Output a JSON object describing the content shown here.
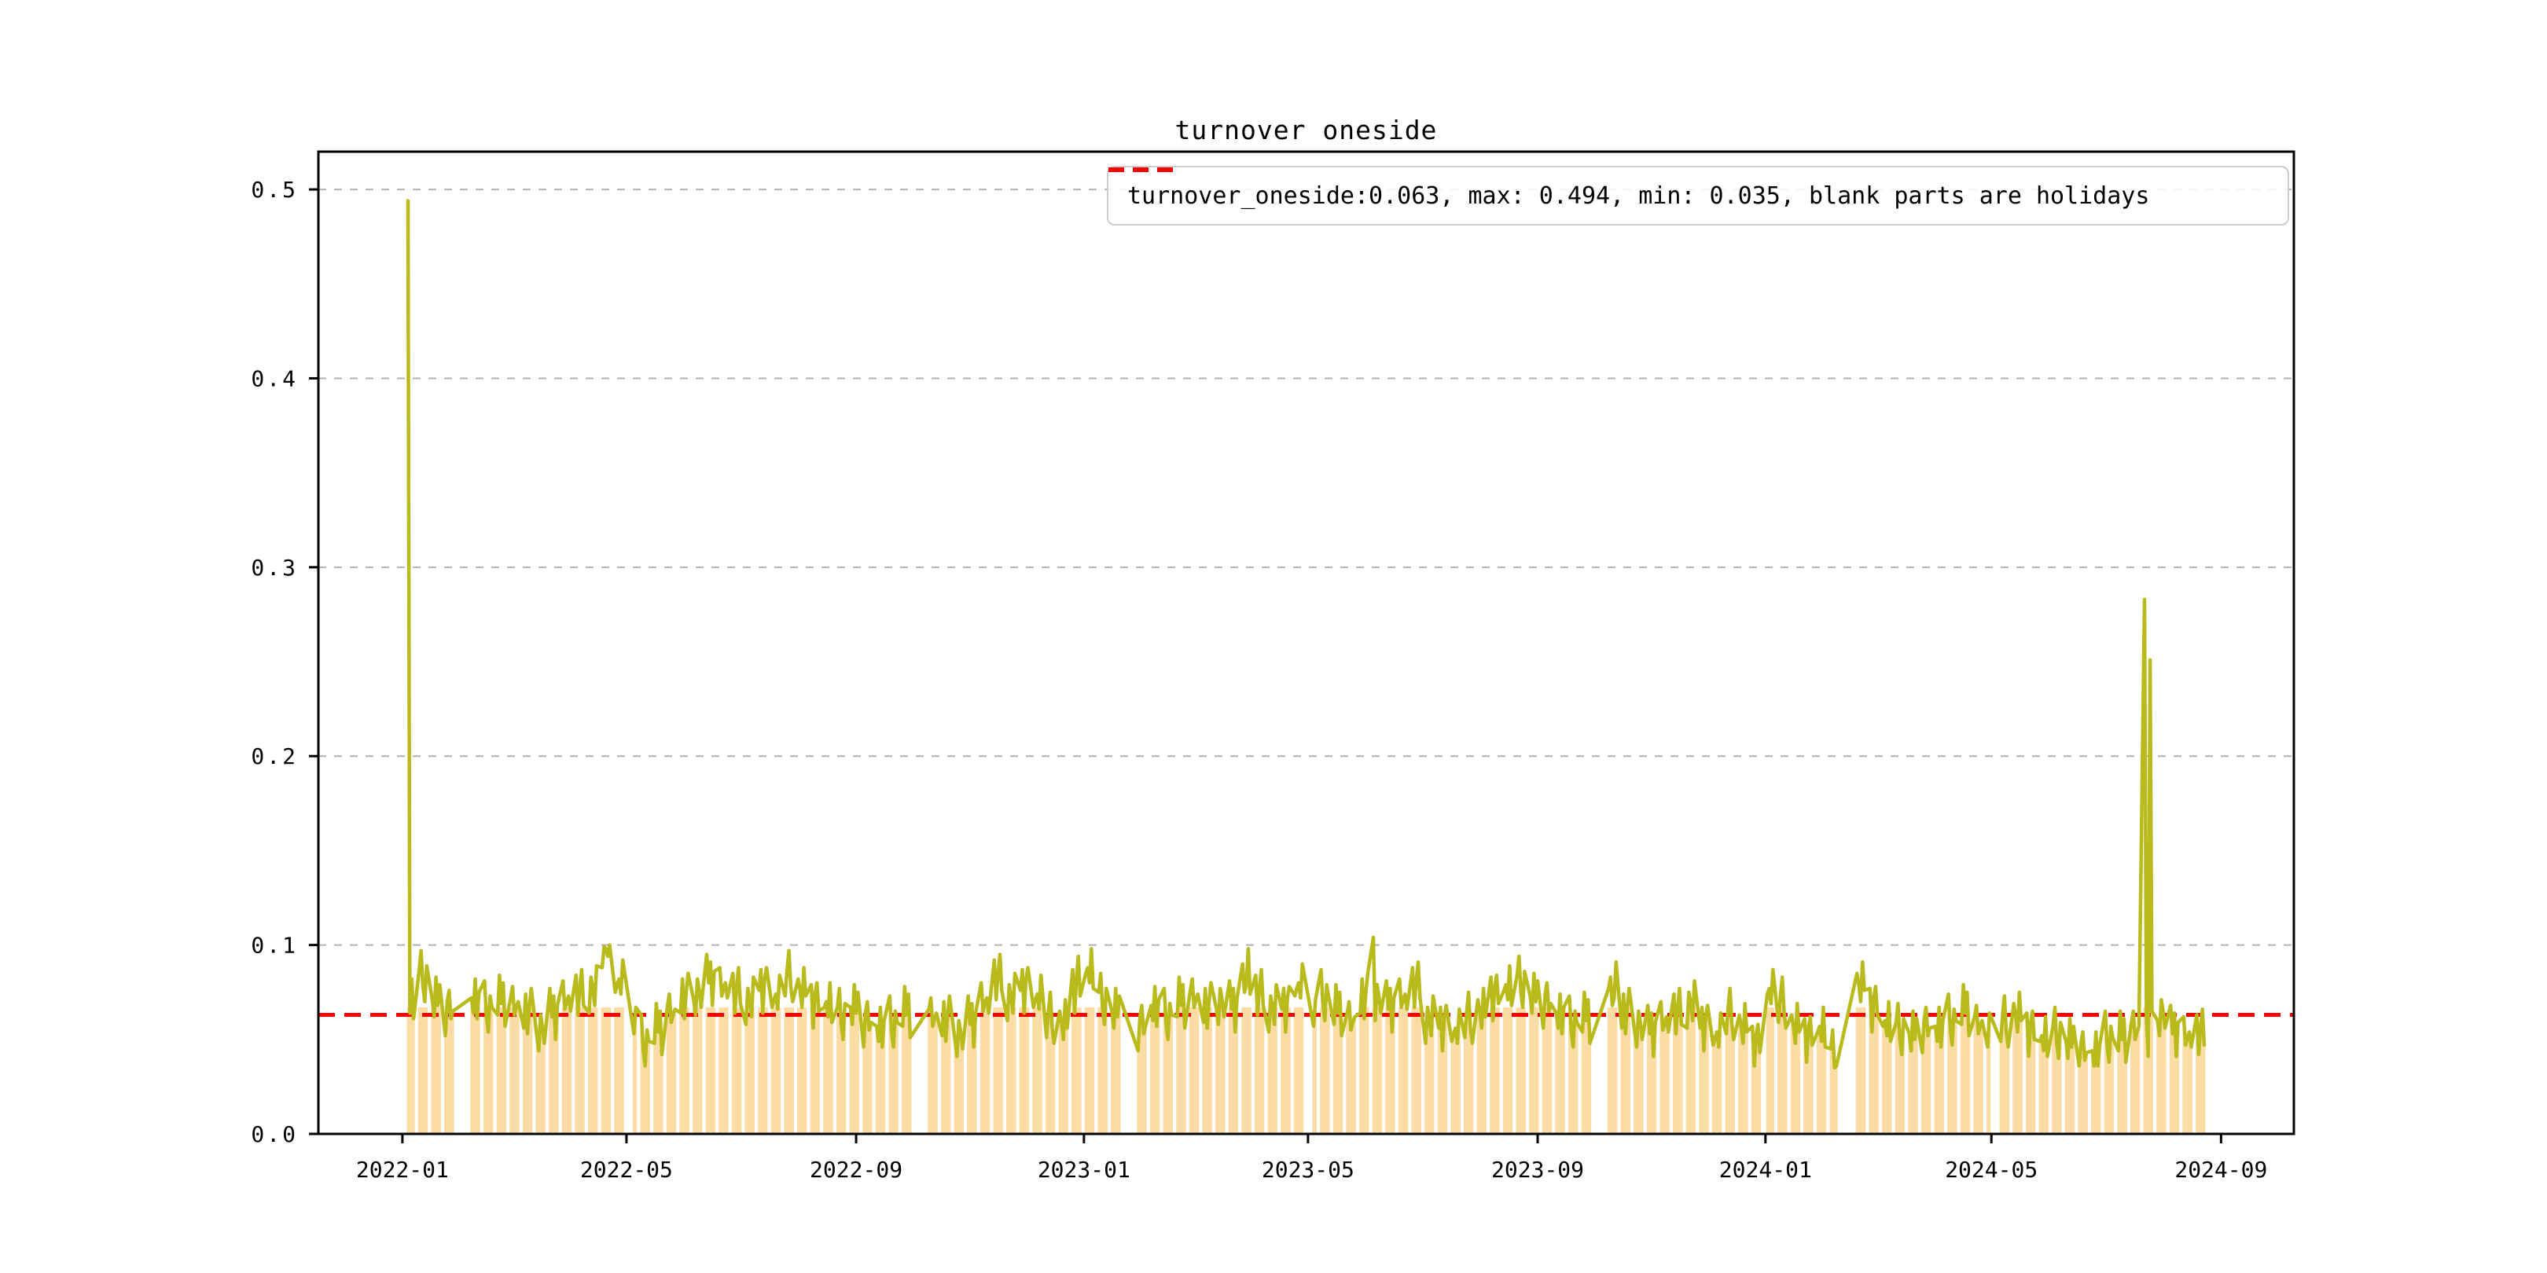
{
  "title": "turnover oneside",
  "legend": {
    "label": "turnover_oneside:0.063, max: 0.494, min: 0.035, blank parts are holidays",
    "marker": "red-dashed-line"
  },
  "chart_data": {
    "type": "line+bar",
    "title": "turnover oneside",
    "xlabel": "",
    "ylabel": "",
    "stats": {
      "mean": 0.063,
      "max": 0.494,
      "min": 0.035
    },
    "mean_line_value": 0.063,
    "ylim": [
      0,
      0.52
    ],
    "xlim_days": [
      -45,
      1013
    ],
    "y_ticks": [
      {
        "label": "0.0",
        "v": 0.0
      },
      {
        "label": "0.1",
        "v": 0.1
      },
      {
        "label": "0.2",
        "v": 0.2
      },
      {
        "label": "0.3",
        "v": 0.3
      },
      {
        "label": "0.4",
        "v": 0.4
      },
      {
        "label": "0.5",
        "v": 0.5
      }
    ],
    "x_ticks": [
      {
        "label": "2022-01",
        "day": 0
      },
      {
        "label": "2022-05",
        "day": 120
      },
      {
        "label": "2022-09",
        "day": 243
      },
      {
        "label": "2023-01",
        "day": 365
      },
      {
        "label": "2023-05",
        "day": 485
      },
      {
        "label": "2023-09",
        "day": 608
      },
      {
        "label": "2024-01",
        "day": 730
      },
      {
        "label": "2024-05",
        "day": 851
      },
      {
        "label": "2024-09",
        "day": 974
      }
    ],
    "grid": true,
    "legend_position": "upper right",
    "colors": {
      "line": "#b9ba1b",
      "bars": "#fbdca4",
      "mean_line": "#ff0000",
      "grid": "#b3b3b3",
      "spine": "#000000",
      "text": "#000000",
      "legend_border": "#cccccc"
    },
    "bar_cap": 0.067,
    "min_clamp": 0.036,
    "intra_day_deltas": [
      0.002,
      -0.006,
      0.012,
      -0.009,
      0.005,
      0.015,
      -0.004,
      -0.012,
      0.007,
      0.001,
      -0.008,
      0.013,
      -0.002,
      0.009,
      -0.014,
      0.004,
      0.01,
      -0.005,
      -0.001
    ],
    "weeks": [
      [
        2,
        0.07,
        [
          1,
          2,
          3,
          4
        ]
      ],
      [
        9,
        0.082
      ],
      [
        16,
        0.07
      ],
      [
        23,
        0.066
      ],
      [
        37,
        0.07
      ],
      [
        44,
        0.066
      ],
      [
        51,
        0.071
      ],
      [
        58,
        0.068
      ],
      [
        65,
        0.062
      ],
      [
        72,
        0.056
      ],
      [
        79,
        0.064
      ],
      [
        86,
        0.071
      ],
      [
        93,
        0.072
      ],
      [
        100,
        0.076
      ],
      [
        107,
        0.09
      ],
      [
        114,
        0.08
      ],
      [
        121,
        0.062,
        [
          3,
          4
        ]
      ],
      [
        128,
        0.048
      ],
      [
        135,
        0.056
      ],
      [
        142,
        0.064
      ],
      [
        149,
        0.07
      ],
      [
        156,
        0.075
      ],
      [
        163,
        0.082
      ],
      [
        170,
        0.078
      ],
      [
        177,
        0.073
      ],
      [
        184,
        0.07
      ],
      [
        191,
        0.078
      ],
      [
        198,
        0.072
      ],
      [
        205,
        0.082
      ],
      [
        212,
        0.075
      ],
      [
        219,
        0.07
      ],
      [
        226,
        0.068
      ],
      [
        233,
        0.062
      ],
      [
        240,
        0.066
      ],
      [
        247,
        0.06
      ],
      [
        254,
        0.055
      ],
      [
        261,
        0.058
      ],
      [
        268,
        0.065
      ],
      [
        282,
        0.062
      ],
      [
        289,
        0.058
      ],
      [
        296,
        0.053
      ],
      [
        303,
        0.06
      ],
      [
        310,
        0.07
      ],
      [
        317,
        0.08
      ],
      [
        324,
        0.072
      ],
      [
        331,
        0.078
      ],
      [
        338,
        0.072
      ],
      [
        345,
        0.06
      ],
      [
        352,
        0.058
      ],
      [
        359,
        0.078
      ],
      [
        366,
        0.086
      ],
      [
        373,
        0.07
      ],
      [
        380,
        0.064
      ],
      [
        394,
        0.058
      ],
      [
        401,
        0.066
      ],
      [
        408,
        0.062
      ],
      [
        415,
        0.07
      ],
      [
        422,
        0.072
      ],
      [
        429,
        0.065
      ],
      [
        436,
        0.07
      ],
      [
        443,
        0.068
      ],
      [
        450,
        0.08
      ],
      [
        457,
        0.072
      ],
      [
        464,
        0.066
      ],
      [
        471,
        0.068
      ],
      [
        478,
        0.078
      ],
      [
        485,
        0.066,
        [
          3,
          4
        ]
      ],
      [
        492,
        0.072
      ],
      [
        499,
        0.066
      ],
      [
        506,
        0.06
      ],
      [
        513,
        0.07
      ],
      [
        520,
        0.072
      ],
      [
        527,
        0.068
      ],
      [
        534,
        0.072
      ],
      [
        541,
        0.076
      ],
      [
        548,
        0.06
      ],
      [
        555,
        0.058
      ],
      [
        562,
        0.054
      ],
      [
        569,
        0.06
      ],
      [
        576,
        0.064
      ],
      [
        583,
        0.074
      ],
      [
        590,
        0.077
      ],
      [
        597,
        0.079
      ],
      [
        604,
        0.072
      ],
      [
        611,
        0.07
      ],
      [
        618,
        0.062
      ],
      [
        625,
        0.058
      ],
      [
        632,
        0.062
      ],
      [
        646,
        0.073
      ],
      [
        653,
        0.062
      ],
      [
        660,
        0.058
      ],
      [
        667,
        0.055
      ],
      [
        674,
        0.06
      ],
      [
        681,
        0.062
      ],
      [
        688,
        0.068
      ],
      [
        695,
        0.058
      ],
      [
        702,
        0.052
      ],
      [
        709,
        0.062
      ],
      [
        716,
        0.056
      ],
      [
        723,
        0.048
      ],
      [
        730,
        0.075,
        [
          1,
          2,
          3,
          4
        ]
      ],
      [
        737,
        0.068
      ],
      [
        744,
        0.056
      ],
      [
        751,
        0.052
      ],
      [
        758,
        0.055
      ],
      [
        765,
        0.04,
        [
          0,
          1,
          2,
          3
        ]
      ],
      [
        779,
        0.078
      ],
      [
        786,
        0.068
      ],
      [
        793,
        0.058
      ],
      [
        800,
        0.054
      ],
      [
        807,
        0.052
      ],
      [
        814,
        0.057
      ],
      [
        821,
        0.055
      ],
      [
        828,
        0.059
      ],
      [
        835,
        0.066
      ],
      [
        842,
        0.058
      ],
      [
        849,
        0.052,
        [
          0,
          1
        ]
      ],
      [
        856,
        0.058
      ],
      [
        863,
        0.062
      ],
      [
        870,
        0.055
      ],
      [
        877,
        0.05
      ],
      [
        884,
        0.052
      ],
      [
        891,
        0.048
      ],
      [
        898,
        0.044
      ],
      [
        905,
        0.042
      ],
      [
        912,
        0.05
      ],
      [
        919,
        0.052
      ],
      [
        926,
        0.055
      ],
      [
        933,
        0.05
      ],
      [
        940,
        0.064
      ],
      [
        947,
        0.055
      ],
      [
        954,
        0.052
      ],
      [
        961,
        0.051
      ]
    ],
    "special_days": [
      [
        3,
        0.494
      ],
      [
        109,
        0.098
      ],
      [
        362,
        0.094
      ],
      [
        453,
        0.098
      ],
      [
        520,
        0.104
      ],
      [
        650,
        0.091
      ],
      [
        767,
        0.035
      ],
      [
        779,
        0.085
      ],
      [
        933,
        0.283
      ],
      [
        936,
        0.251
      ]
    ]
  }
}
